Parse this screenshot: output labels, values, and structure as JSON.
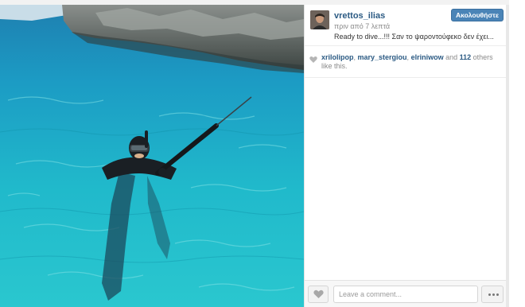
{
  "post": {
    "username": "vrettos_ilias",
    "time_ago": "πριν από 7 λεπτά",
    "caption": "Ready to dive...!!! Σαν το ψαροντούφεκο δεν έχει...",
    "follow_label": "Ακολουθήστε"
  },
  "likes": {
    "users": [
      "xrilolipop",
      "mary_stergiou",
      "elriniwow"
    ],
    "separator": ", ",
    "and_word": " and ",
    "others_count": "112",
    "others_suffix": " others like this."
  },
  "comment_box": {
    "placeholder": "Leave a comment..."
  },
  "icons": {
    "like": "heart-icon",
    "more": "ellipsis-icon"
  },
  "colors": {
    "link": "#2b5a83",
    "follow_button": "#4a84b7",
    "water": "#21b8c9"
  }
}
